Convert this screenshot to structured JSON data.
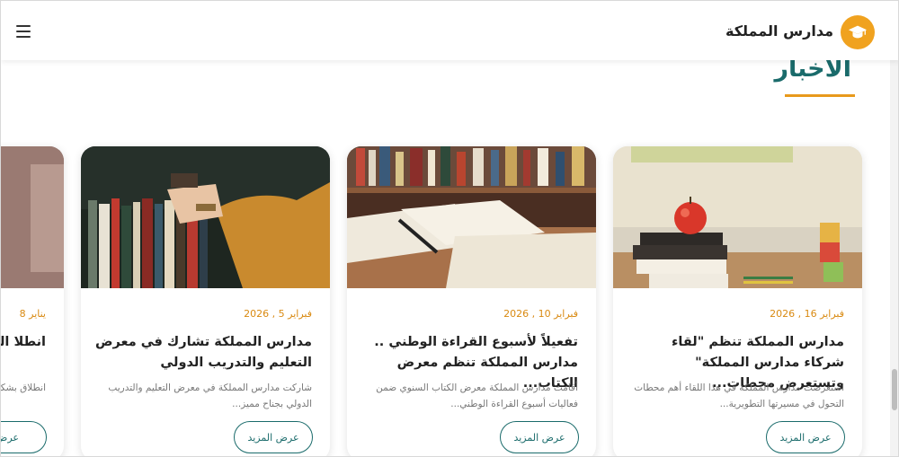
{
  "header": {
    "brand": "مدارس المملكة",
    "logo_icon": "graduation-cap-icon",
    "menu_icon": "hamburger-menu-icon"
  },
  "section": {
    "title": "الآخبار"
  },
  "colors": {
    "accent": "#f0a21f",
    "primary": "#1a6b6b",
    "date": "#d98a12"
  },
  "cards": [
    {
      "date": "فبراير 16 , 2026",
      "title": "مدارس المملكة تنظم \"لقاء شركاء مدارس المملكة\" وتستعرض محطات...",
      "desc": "استعرضت مدارس المملكة في هذا اللقاء أهم محطات التحول في مسيرتها التطويرية...",
      "button": "عرض المزيد"
    },
    {
      "date": "فبراير 10 , 2026",
      "title": "تفعيلاً لأسبوع القراءة الوطني .. مدارس المملكة تنظم معرض الكتاب...",
      "desc": "أقامت مدارس المملكة معرض الكتاب السنوي ضمن فعاليات أسبوع القراءة الوطني...",
      "button": "عرض المزيد"
    },
    {
      "date": "فبراير 5 , 2026",
      "title": "مدارس المملكة تشارك في معرض التعليم والتدريب الدولي",
      "desc": "شاركت مدارس المملكة في معرض التعليم والتدريب الدولي بجناح مميز...",
      "button": "عرض المزيد"
    },
    {
      "date": "يناير 8",
      "title": "انطلا المد",
      "desc": "انطلاق بشكل",
      "button": "عرض"
    }
  ]
}
